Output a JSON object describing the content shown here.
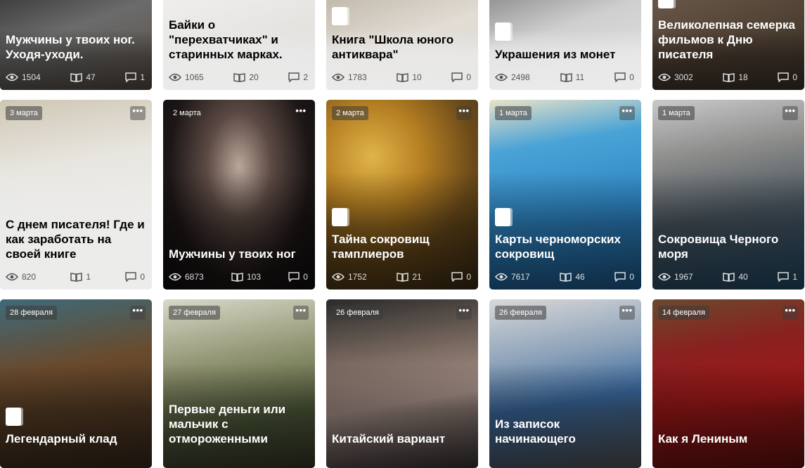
{
  "rows": [
    [
      {
        "title": "Мужчины у твоих ног. Уходя-уходи.",
        "views": "1504",
        "reads": "47",
        "comments": "1"
      },
      {
        "title": "Байки о \"перехватчиках\" и старинных марках.",
        "views": "1065",
        "reads": "20",
        "comments": "2"
      },
      {
        "title": "Книга \"Школа юного антиквара\"",
        "views": "1783",
        "reads": "10",
        "comments": "0"
      },
      {
        "title": "Украшения из монет",
        "views": "2498",
        "reads": "11",
        "comments": "0"
      },
      {
        "title": "Великолепная семерка фильмов к Дню писателя",
        "views": "3002",
        "reads": "18",
        "comments": "0"
      }
    ],
    [
      {
        "date": "3 марта",
        "title": "С днем писателя! Где и как заработать на своей книге",
        "views": "820",
        "reads": "1",
        "comments": "0"
      },
      {
        "date": "2 марта",
        "title": "Мужчины у твоих ног",
        "views": "6873",
        "reads": "103",
        "comments": "0"
      },
      {
        "date": "2 марта",
        "title": "Тайна сокровищ тамплиеров",
        "views": "1752",
        "reads": "21",
        "comments": "0"
      },
      {
        "date": "1 марта",
        "title": "Карты черноморских сокровищ",
        "views": "7617",
        "reads": "46",
        "comments": "0"
      },
      {
        "date": "1 марта",
        "title": "Сокровища Черного моря",
        "views": "1967",
        "reads": "40",
        "comments": "1"
      }
    ],
    [
      {
        "date": "28 февраля",
        "title": "Легендарный клад"
      },
      {
        "date": "27 февраля",
        "title": "Первые деньги или мальчик с отмороженными"
      },
      {
        "date": "26 февраля",
        "title": "Китайский вариант"
      },
      {
        "date": "26 февраля",
        "title": "Из записок начинающего"
      },
      {
        "date": "14 февраля",
        "title": "Как я Лениным"
      }
    ]
  ],
  "menu_label": "•••",
  "icons": {
    "views": "eye-icon",
    "reads": "book-icon",
    "comments": "comment-icon",
    "menu": "more-dots-icon",
    "badge": "document-icon"
  }
}
